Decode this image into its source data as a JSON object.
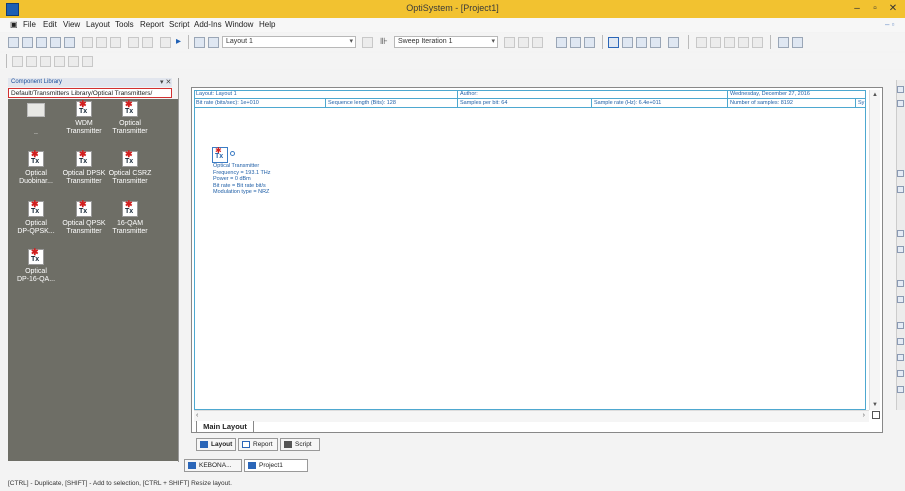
{
  "window": {
    "title": "OptiSystem - [Project1]",
    "controls": [
      "–",
      "▫",
      "✕"
    ]
  },
  "menu": [
    "File",
    "Edit",
    "View",
    "Layout",
    "Tools",
    "Report",
    "Script",
    "Add-Ins",
    "Window",
    "Help"
  ],
  "toolbar": {
    "layout_combo": "Layout 1",
    "sweep_combo": "Sweep Iteration 1"
  },
  "library": {
    "header": "Component Library",
    "pin": "▾ ✕",
    "path": "Default/Transmitters Library/Optical Transmitters/",
    "items": [
      {
        "label": "..",
        "icon": "folder-up-icon"
      },
      {
        "label": "WDM\nTransmitter",
        "icon": "tx-icon"
      },
      {
        "label": "Optical\nTransmitter",
        "icon": "tx-icon"
      },
      {
        "label": "Optical\nDuobinar...",
        "icon": "tx-duobinary-icon"
      },
      {
        "label": "Optical DPSK\nTransmitter",
        "icon": "tx-dpsk-icon"
      },
      {
        "label": "Optical CSRZ\nTransmitter",
        "icon": "tx-csrz-icon"
      },
      {
        "label": "Optical\nDP-QPSK...",
        "icon": "tx-dpqpsk-icon"
      },
      {
        "label": "Optical QPSK\nTransmitter",
        "icon": "tx-qpsk-icon"
      },
      {
        "label": "16-QAM\nTransmitter",
        "icon": "tx-16qam-icon"
      },
      {
        "label": "Optical\nDP-16-QA...",
        "icon": "tx-dp16qam-icon"
      }
    ]
  },
  "sheet": {
    "row1": {
      "layout": "Layout: Layout 1",
      "author": "Author:",
      "date": "Wednesday, December 27, 2016"
    },
    "row2": {
      "bitrate": "Bit rate (bits/sec): 1e+010",
      "seq_len": "Sequence length (Bits): 128",
      "samples_per_bit": "Samples per bit: 64",
      "sample_rate": "Sample rate (Hz): 6.4e+011",
      "num_samples": "Number of samples: 8192",
      "extra": "Sy"
    }
  },
  "component_on_canvas": {
    "name": "Optical Transmitter",
    "params": [
      "Optical Transmitter",
      "Frequency = 193.1 THz",
      "Power = 0 dBm",
      "Bit rate = Bit rate bit/s",
      "Modulation type = NRZ"
    ]
  },
  "tabs": {
    "main_layout": "Main Layout",
    "sub": [
      "Layout",
      "Report",
      "Script"
    ],
    "docs": [
      "KEBONA...",
      "Project1"
    ]
  },
  "status": "[CTRL] - Duplicate, [SHIFT] - Add to selection, [CTRL + SHIFT] Resize layout."
}
